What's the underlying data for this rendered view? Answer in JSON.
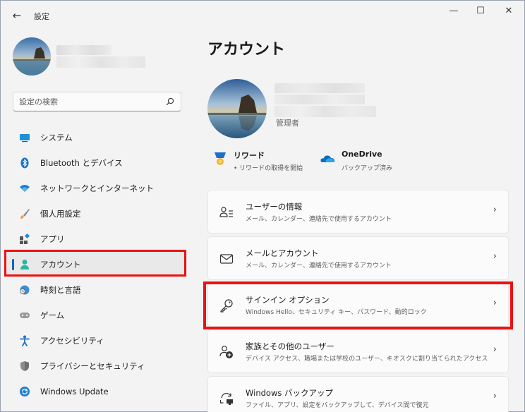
{
  "window": {
    "title": "設定",
    "controls": {
      "minimize": "—",
      "maximize": "☐",
      "close": "✕"
    }
  },
  "search": {
    "placeholder": "設定の検索"
  },
  "sidebar": {
    "items": [
      {
        "label": "システム",
        "icon": "monitor-icon"
      },
      {
        "label": "Bluetooth とデバイス",
        "icon": "bluetooth-icon"
      },
      {
        "label": "ネットワークとインターネット",
        "icon": "wifi-icon"
      },
      {
        "label": "個人用設定",
        "icon": "brush-icon"
      },
      {
        "label": "アプリ",
        "icon": "apps-icon"
      },
      {
        "label": "アカウント",
        "icon": "account-icon",
        "active": true
      },
      {
        "label": "時刻と言語",
        "icon": "globe-clock-icon"
      },
      {
        "label": "ゲーム",
        "icon": "gamepad-icon"
      },
      {
        "label": "アクセシビリティ",
        "icon": "accessibility-icon"
      },
      {
        "label": "プライバシーとセキュリティ",
        "icon": "shield-icon"
      },
      {
        "label": "Windows Update",
        "icon": "update-icon"
      }
    ]
  },
  "main": {
    "title": "アカウント",
    "profile": {
      "role": "管理者"
    },
    "quick": {
      "rewards": {
        "title": "リワード",
        "subtitle": "• リワードの取得を開始"
      },
      "onedrive": {
        "title": "OneDrive",
        "subtitle": "バックアップ済み"
      }
    },
    "cards": [
      {
        "title": "ユーザーの情報",
        "subtitle": "メール、カレンダー、連絡先で使用するアカウント",
        "icon": "person-info-icon"
      },
      {
        "title": "メールとアカウント",
        "subtitle": "メール、カレンダー、連絡先で使用するアカウント",
        "icon": "mail-icon"
      },
      {
        "title": "サインイン オプション",
        "subtitle": "Windows Hello、セキュリティ キー、パスワード、動的ロック",
        "icon": "key-icon"
      },
      {
        "title": "家族とその他のユーザー",
        "subtitle": "デバイス アクセス、職場または学校のユーザー、キオスクに割り当てられたアクセス",
        "icon": "add-person-icon"
      },
      {
        "title": "Windows バックアップ",
        "subtitle": "ファイル、アプリ、設定をバックアップして、デバイス間で復元",
        "icon": "backup-icon"
      }
    ],
    "chevron": "›"
  },
  "colors": {
    "accent": "#0067c0",
    "highlight": "#ee1111",
    "background": "#f3f3f3"
  }
}
